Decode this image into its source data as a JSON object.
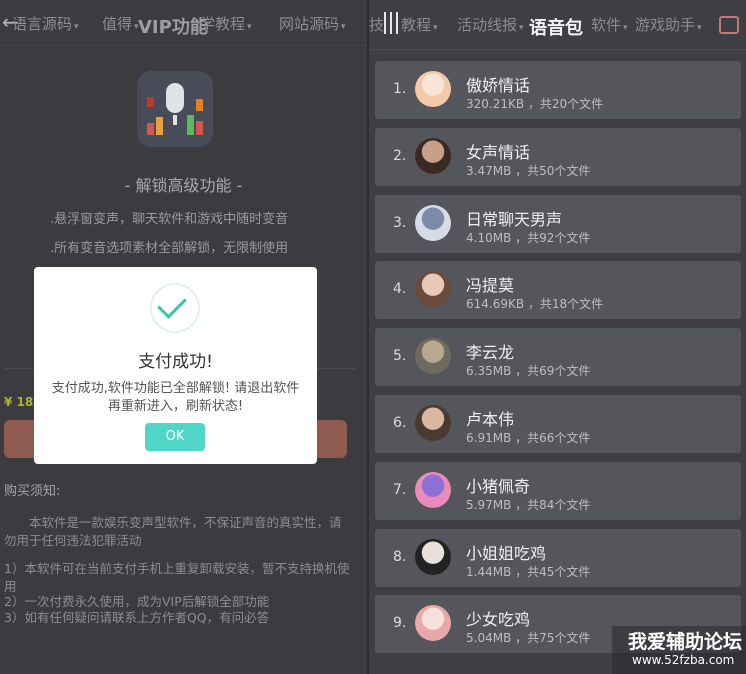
{
  "left": {
    "nav": [
      {
        "label": "语言源码"
      },
      {
        "label": "值得"
      },
      {
        "label": "学教程"
      },
      {
        "label": "网站源码"
      }
    ],
    "title": "VIP功能",
    "unlock_title": "- 解锁高级功能 -",
    "features": [
      ".悬浮窗变声，聊天软件和游戏中随时变音",
      ".所有变音选项素材全部解锁，无限制使用"
    ],
    "price": "¥ 18.",
    "notice_title": "购买须知:",
    "notice_body": "本软件是一款娱乐变声型软件，不保证声音的真实性，请勿用于任何违法犯罪活动",
    "notice_items": [
      "1）本软件可在当前支付手机上重复卸载安装，暂不支持换机使用",
      "2）一次付费永久使用，成为VIP后解锁全部功能",
      "3）如有任何疑问请联系上方作者QQ，有问必答"
    ]
  },
  "dialog": {
    "title": "支付成功!",
    "message": "支付成功,软件功能已全部解锁! 请退出软件再重新进入，刷新状态!",
    "ok_label": "OK"
  },
  "right": {
    "nav": [
      {
        "label": "技"
      },
      {
        "label": "教程"
      },
      {
        "label": "活动线报"
      },
      {
        "label": "软件"
      },
      {
        "label": "游戏助手"
      }
    ],
    "title": "语音包",
    "items": [
      {
        "index": "1.",
        "name": "傲娇情话",
        "meta": "320.21KB  ，共20个文件",
        "avatar_color": "#f3c9a8",
        "avatar_color2": "#f7e6d8"
      },
      {
        "index": "2.",
        "name": "女声情话",
        "meta": "3.47MB  ，共50个文件",
        "avatar_color": "#3b2a24",
        "avatar_color2": "#c8a08a"
      },
      {
        "index": "3.",
        "name": "日常聊天男声",
        "meta": "4.10MB  ，共92个文件",
        "avatar_color": "#d7dbe6",
        "avatar_color2": "#7d8aa8"
      },
      {
        "index": "4.",
        "name": "冯提莫",
        "meta": "614.69KB  ，共18个文件",
        "avatar_color": "#6a4b3e",
        "avatar_color2": "#e8c8b8"
      },
      {
        "index": "5.",
        "name": "李云龙",
        "meta": "6.35MB  ，共69个文件",
        "avatar_color": "#6e6a5e",
        "avatar_color2": "#b8a890"
      },
      {
        "index": "6.",
        "name": "卢本伟",
        "meta": "6.91MB  ，共66个文件",
        "avatar_color": "#4a3a30",
        "avatar_color2": "#d8b8a0"
      },
      {
        "index": "7.",
        "name": "小猪佩奇",
        "meta": "5.97MB  ，共84个文件",
        "avatar_color": "#e98bb8",
        "avatar_color2": "#8e6fd8"
      },
      {
        "index": "8.",
        "name": "小姐姐吃鸡",
        "meta": "1.44MB  ，共45个文件",
        "avatar_color": "#222",
        "avatar_color2": "#e8e0dc"
      },
      {
        "index": "9.",
        "name": "少女吃鸡",
        "meta": "5.04MB  ，共75个文件",
        "avatar_color": "#e8a8a8",
        "avatar_color2": "#f6e0dc"
      }
    ]
  },
  "watermark": {
    "name": "我爱辅助论坛",
    "url": "www.52fzba.com"
  }
}
